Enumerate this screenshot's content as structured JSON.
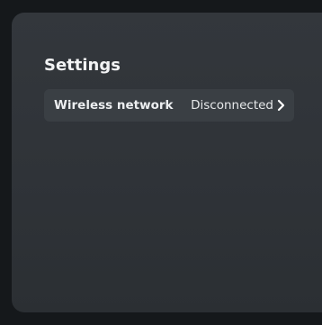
{
  "settings": {
    "title": "Settings",
    "rows": [
      {
        "label": "Wireless network",
        "status": "Disconnected",
        "icon": "chevron-right-icon"
      }
    ]
  },
  "colors": {
    "background": "#2f3338",
    "row_background": "#3a3f44",
    "text": "#f2f3f4"
  }
}
